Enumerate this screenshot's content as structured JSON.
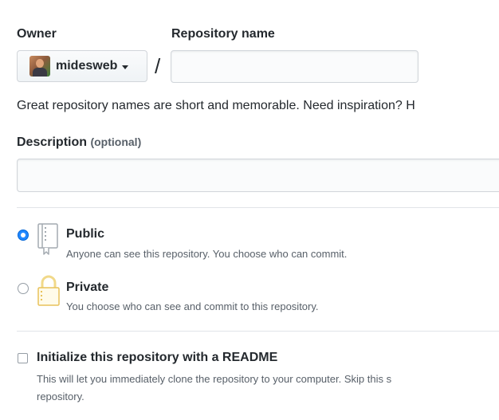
{
  "form": {
    "owner_label": "Owner",
    "repo_name_label": "Repository name",
    "owner_value": "midesweb",
    "separator": "/",
    "repo_name_value": "",
    "hint": "Great repository names are short and memorable. Need inspiration? H",
    "description_label": "Description",
    "description_optional": "(optional)",
    "description_value": ""
  },
  "visibility": {
    "selected": "public",
    "public": {
      "title": "Public",
      "description": "Anyone can see this repository. You choose who can commit.",
      "icon": "repo-book-icon"
    },
    "private": {
      "title": "Private",
      "description": "You choose who can see and commit to this repository.",
      "icon": "lock-icon"
    }
  },
  "readme": {
    "checked": false,
    "label": "Initialize this repository with a README",
    "description_line1": "This will let you immediately clone the repository to your computer. Skip this s",
    "description_line2": "repository."
  },
  "colors": {
    "accent": "#2188ff",
    "border": "#d1d5da",
    "muted_text": "#586069",
    "lock_icon": "#dbab09"
  }
}
